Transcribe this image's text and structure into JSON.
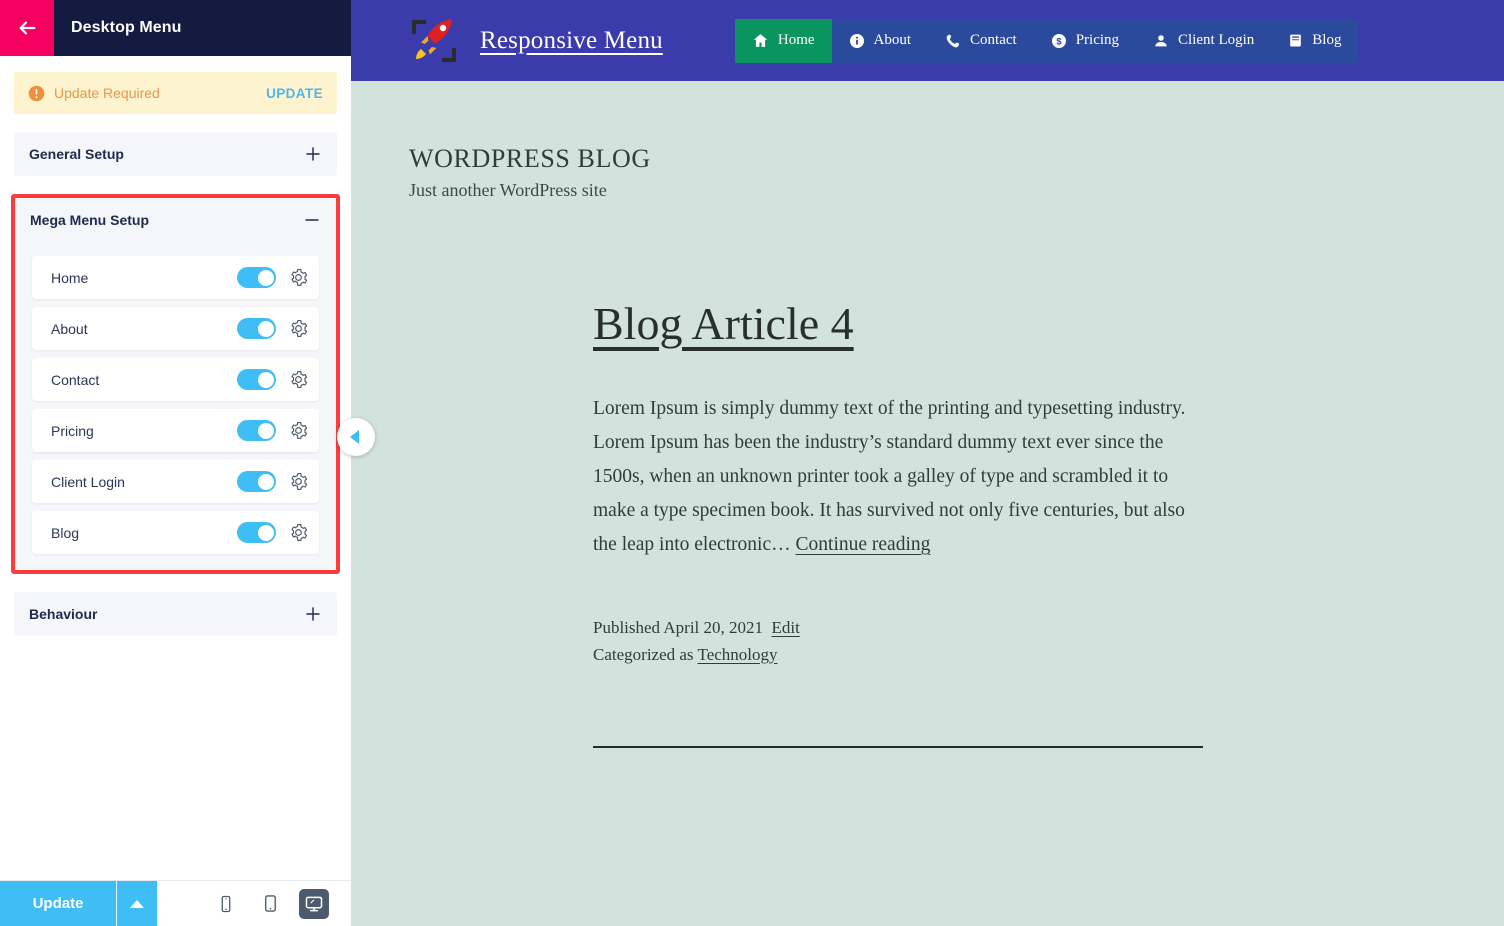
{
  "panel": {
    "back_icon": "arrow-left-icon",
    "title": "Desktop Menu",
    "notice": {
      "icon": "alert-circle-icon",
      "text": "Update Required",
      "action_label": "UPDATE"
    },
    "sections": [
      {
        "title": "General Setup",
        "state_icon": "plus-icon",
        "expanded": false
      },
      {
        "title": "Behaviour",
        "state_icon": "plus-icon",
        "expanded": false
      }
    ],
    "mega_menu": {
      "title": "Mega Menu Setup",
      "state_icon": "minus-icon",
      "expanded": true,
      "highlight_color": "#fc3d3d",
      "items": [
        {
          "label": "Home",
          "enabled": true,
          "settings_icon": "gear-icon"
        },
        {
          "label": "About",
          "enabled": true,
          "settings_icon": "gear-icon"
        },
        {
          "label": "Contact",
          "enabled": true,
          "settings_icon": "gear-icon"
        },
        {
          "label": "Pricing",
          "enabled": true,
          "settings_icon": "gear-icon"
        },
        {
          "label": "Client Login",
          "enabled": true,
          "settings_icon": "gear-icon"
        },
        {
          "label": "Blog",
          "enabled": true,
          "settings_icon": "gear-icon"
        }
      ]
    },
    "footer": {
      "update_label": "Update",
      "caret_icon": "caret-up-icon",
      "devices": [
        {
          "name": "mobile-icon",
          "active": false
        },
        {
          "name": "tablet-icon",
          "active": false
        },
        {
          "name": "desktop-icon",
          "active": true
        }
      ]
    },
    "collapse_icon": "chevron-left-icon",
    "colors": {
      "header_bg": "#141b41",
      "back_bg": "#f5005e",
      "accent": "#3fbdf5",
      "notice_bg": "#fdf3cf",
      "notice_text": "#e8964a"
    }
  },
  "preview": {
    "brand": {
      "logo_icon": "rocket-logo-icon",
      "name": "Responsive Menu"
    },
    "nav": [
      {
        "label": "Home",
        "icon": "home-icon",
        "active": true
      },
      {
        "label": "About",
        "icon": "info-circle-icon",
        "active": false
      },
      {
        "label": "Contact",
        "icon": "phone-icon",
        "active": false
      },
      {
        "label": "Pricing",
        "icon": "dollar-circle-icon",
        "active": false
      },
      {
        "label": "Client Login",
        "icon": "user-icon",
        "active": false
      },
      {
        "label": "Blog",
        "icon": "book-icon",
        "active": false
      }
    ],
    "site": {
      "title": "WORDPRESS BLOG",
      "tagline": "Just another WordPress site"
    },
    "article": {
      "title": "Blog Article 4",
      "body": "Lorem Ipsum is simply dummy text of the printing and typesetting industry. Lorem Ipsum has been the industry’s standard dummy text ever since the 1500s, when an unknown printer took a galley of type and scrambled it to make a type specimen book. It has survived not only five centuries, but also the leap into electronic… ",
      "continue_label": "Continue reading",
      "published_prefix": "Published",
      "published_date": "April 20, 2021",
      "edit_label": "Edit",
      "category_prefix": "Categorized as",
      "category": "Technology"
    },
    "colors": {
      "nav_bg": "#3c3bab",
      "nav_items_bg": "#2c4a9c",
      "active_bg": "#0a9460",
      "page_bg": "#d2e2dc"
    }
  }
}
